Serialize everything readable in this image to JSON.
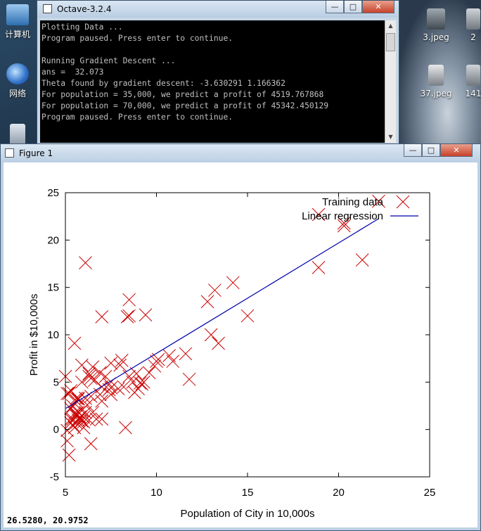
{
  "desktop": {
    "icons": [
      {
        "label": "计算机",
        "icon": "computer-icon"
      },
      {
        "label": "网络",
        "icon": "network-icon"
      },
      {
        "label": "",
        "icon": "recycle-bin-icon"
      },
      {
        "label": "3.jpeg",
        "icon": "image-file-icon"
      },
      {
        "label": "37.jpeg",
        "icon": "image-file-icon"
      },
      {
        "label": "2",
        "icon": "image-file-icon"
      },
      {
        "label": "141",
        "icon": "image-file-icon"
      }
    ]
  },
  "console": {
    "title": "Octave-3.2.4",
    "lines": [
      "Plotting Data ...",
      "Program paused. Press enter to continue.",
      "",
      "Running Gradient Descent ...",
      "ans =  32.073",
      "Theta found by gradient descent: -3.630291 1.166362",
      "For population = 35,000, we predict a profit of 4519.767868",
      "For population = 70,000, we predict a profit of 45342.450129",
      "Program paused. Press enter to continue."
    ]
  },
  "figure": {
    "title": "Figure 1",
    "coord_readout": "26.5280, 20.9752"
  },
  "colors": {
    "data": "#cc0000",
    "line": "#0000aa"
  },
  "chart_data": {
    "type": "scatter",
    "xlabel": "Population of City in 10,000s",
    "ylabel": "Profit in $10,000s",
    "xlim": [
      5,
      25
    ],
    "ylim": [
      -5,
      25
    ],
    "xticks": [
      5,
      10,
      15,
      20,
      25
    ],
    "yticks": [
      -5,
      0,
      5,
      10,
      15,
      20,
      25
    ],
    "grid": false,
    "legend_position": "top-right",
    "series": [
      {
        "name": "Training data",
        "marker": "x",
        "color": "#cc0000",
        "points": [
          [
            6.1,
            17.6
          ],
          [
            5.5,
            9.1
          ],
          [
            8.5,
            13.7
          ],
          [
            7.0,
            11.9
          ],
          [
            5.9,
            6.8
          ],
          [
            8.4,
            11.9
          ],
          [
            5.6,
            3.3
          ],
          [
            8.5,
            12.0
          ],
          [
            6.5,
            6.6
          ],
          [
            5.1,
            3.8
          ],
          [
            5.7,
            3.3
          ],
          [
            14.2,
            15.5
          ],
          [
            5.7,
            3.2
          ],
          [
            6.3,
            5.6
          ],
          [
            5.6,
            3.0
          ],
          [
            5.2,
            3.8
          ],
          [
            7.9,
            4.3
          ],
          [
            6.3,
            1.0
          ],
          [
            5.3,
            4.1
          ],
          [
            5.8,
            1.3
          ],
          [
            7.0,
            3.0
          ],
          [
            5.9,
            2.0
          ],
          [
            8.3,
            0.2
          ],
          [
            7.5,
            4.4
          ],
          [
            7.0,
            4.5
          ],
          [
            5.6,
            1.4
          ],
          [
            6.2,
            2.6
          ],
          [
            7.4,
            4.2
          ],
          [
            13.4,
            9.1
          ],
          [
            8.9,
            5.9
          ],
          [
            8.1,
            7.3
          ],
          [
            10.7,
            7.8
          ],
          [
            7.2,
            5.6
          ],
          [
            6.3,
            5.9
          ],
          [
            7.5,
            3.7
          ],
          [
            13.2,
            14.7
          ],
          [
            9.4,
            12.1
          ],
          [
            10.9,
            7.2
          ],
          [
            12.8,
            13.5
          ],
          [
            15.0,
            12.0
          ],
          [
            11.6,
            8.0
          ],
          [
            13.0,
            10.0
          ],
          [
            10.0,
            7.2
          ],
          [
            7.5,
            7.0
          ],
          [
            11.8,
            5.3
          ],
          [
            10.1,
            7.4
          ],
          [
            18.9,
            17.1
          ],
          [
            20.3,
            21.8
          ],
          [
            21.3,
            17.9
          ],
          [
            22.2,
            24.1
          ],
          [
            18.9,
            22.7
          ],
          [
            20.3,
            21.5
          ],
          [
            5.5,
            0.2
          ],
          [
            6.1,
            3.3
          ],
          [
            5.1,
            -1.2
          ],
          [
            6.4,
            -1.5
          ],
          [
            5.2,
            -2.7
          ],
          [
            5.0,
            5.6
          ],
          [
            5.3,
            0.7
          ],
          [
            5.9,
            0.9
          ],
          [
            5.8,
            1.3
          ],
          [
            6.5,
            1.8
          ],
          [
            5.4,
            2.5
          ],
          [
            5.7,
            1.8
          ],
          [
            5.6,
            1.7
          ],
          [
            5.4,
            0.5
          ],
          [
            5.3,
            1.1
          ],
          [
            6.0,
            0.8
          ],
          [
            8.7,
            5.0
          ],
          [
            9.0,
            4.3
          ],
          [
            9.3,
            5.0
          ],
          [
            9.9,
            6.7
          ],
          [
            8.2,
            4.5
          ],
          [
            8.8,
            3.9
          ],
          [
            9.6,
            6.0
          ],
          [
            8.5,
            5.6
          ],
          [
            9.1,
            4.9
          ],
          [
            6.4,
            5.4
          ],
          [
            6.9,
            3.7
          ],
          [
            6.7,
            1.1
          ],
          [
            6.1,
            1.8
          ],
          [
            7.4,
            4.8
          ],
          [
            5.1,
            -0.1
          ],
          [
            5.7,
            1.0
          ],
          [
            6.6,
            5.2
          ],
          [
            6.9,
            6.0
          ],
          [
            5.9,
            5.0
          ],
          [
            8.0,
            6.8
          ],
          [
            5.6,
            0.7
          ],
          [
            5.3,
            2.2
          ],
          [
            5.5,
            1.7
          ],
          [
            6.0,
            1.3
          ],
          [
            7.0,
            1.1
          ],
          [
            6.4,
            3.5
          ],
          [
            6.0,
            0.2
          ],
          [
            5.4,
            1.1
          ],
          [
            9.2,
            4.8
          ]
        ]
      },
      {
        "name": "Linear regression",
        "color": "#0000aa",
        "type": "line",
        "points": [
          [
            5.03,
            2.24
          ],
          [
            22.2,
            22.26
          ]
        ]
      }
    ]
  }
}
